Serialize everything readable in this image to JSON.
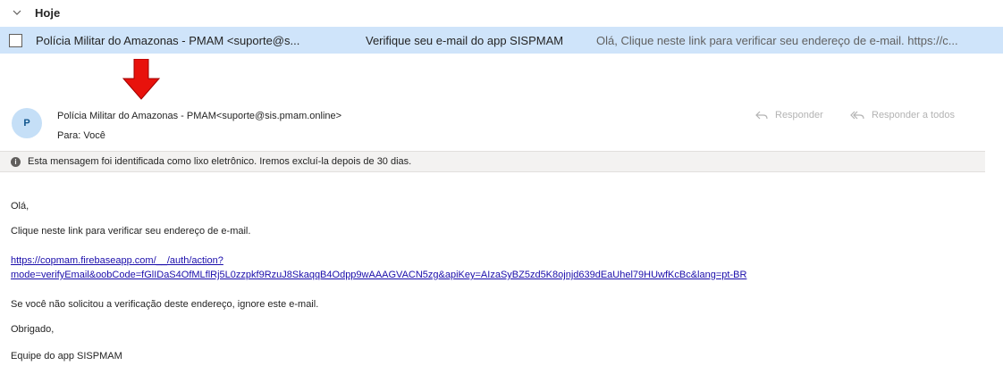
{
  "message_list": {
    "group_title": "Hoje",
    "row": {
      "sender": "Polícia Militar do Amazonas - PMAM <suporte@s...",
      "subject": "Verifique seu e-mail do app SISPMAM",
      "preview": "Olá, Clique neste link para verificar seu endereço de e-mail. https://c..."
    }
  },
  "reading_pane": {
    "avatar_initial": "P",
    "from": "Polícia Militar do Amazonas - PMAM<suporte@sis.pmam.online>",
    "to": "Para: Você",
    "reply_label": "Responder",
    "reply_all_label": "Responder a todos",
    "junk_notice": "Esta mensagem foi identificada como lixo eletrônico. Iremos excluí-la depois de 30 dias.",
    "body": {
      "greeting": "Olá,",
      "instruction": "Clique neste link para verificar seu endereço de e-mail.",
      "link_line1": "https://copmam.firebaseapp.com/__/auth/action?",
      "link_line2": "mode=verifyEmail&oobCode=fGlIDaS4OfMLflRj5L0zzpkf9RzuJ8SkaqqB4Odpp9wAAAGVACN5zg&apiKey=AIzaSyBZ5zd5K8ojnjd639dEaUhel79HUwfKcBc&lang=pt-BR",
      "ignore_note": "Se você não solicitou a verificação deste endereço, ignore este e-mail.",
      "thanks": "Obrigado,",
      "signature": "Equipe do app SISPMAM"
    }
  },
  "colors": {
    "selected_row": "#cfe4fa",
    "arrow": "#e8120c",
    "link": "#1a0dab",
    "banner": "#f3f2f1"
  },
  "icons": [
    "chevron-down-icon",
    "checkbox-icon",
    "arrow-down-icon",
    "reply-icon",
    "reply-all-icon",
    "info-icon"
  ]
}
